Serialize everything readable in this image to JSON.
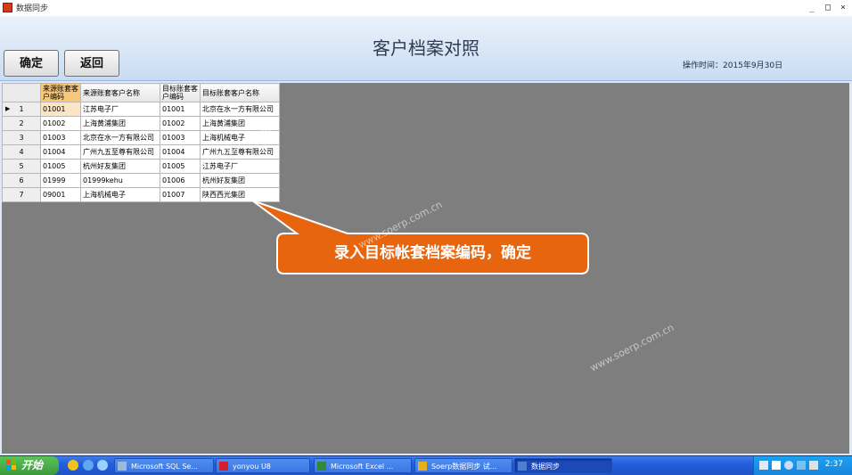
{
  "window": {
    "title": "数据同步",
    "minimize_glyph": "_",
    "maximize_glyph": "□",
    "close_glyph": "×"
  },
  "header": {
    "heading": "客户档案对照",
    "op_time": "操作时间：2015年9月30日"
  },
  "toolbar": {
    "confirm_label": "确定",
    "back_label": "返回"
  },
  "grid": {
    "columns": [
      "来源账套客户编码",
      "来源账套客户名称",
      "目标账套客户编码",
      "目标账套客户名称"
    ],
    "current_row_marker": "▶",
    "rows": [
      {
        "num": "1",
        "src_code": "01001",
        "src_name": "江苏电子厂",
        "tgt_code": "01001",
        "tgt_name": "北京在水一方有限公司"
      },
      {
        "num": "2",
        "src_code": "01002",
        "src_name": "上海黄浦集团",
        "tgt_code": "01002",
        "tgt_name": "上海黄浦集团"
      },
      {
        "num": "3",
        "src_code": "01003",
        "src_name": "北京在水一方有限公司",
        "tgt_code": "01003",
        "tgt_name": "上海机械电子"
      },
      {
        "num": "4",
        "src_code": "01004",
        "src_name": "广州九五至尊有限公司",
        "tgt_code": "01004",
        "tgt_name": "广州九五至尊有限公司"
      },
      {
        "num": "5",
        "src_code": "01005",
        "src_name": "杭州好友集团",
        "tgt_code": "01005",
        "tgt_name": "江苏电子厂"
      },
      {
        "num": "6",
        "src_code": "01999",
        "src_name": "01999kehu",
        "tgt_code": "01006",
        "tgt_name": "杭州好友集团"
      },
      {
        "num": "7",
        "src_code": "09001",
        "src_name": "上海机械电子",
        "tgt_code": "01007",
        "tgt_name": "陕西西光集团"
      }
    ]
  },
  "callout": {
    "text": "录入目标帐套档案编码，确定",
    "fill": "#e8650f",
    "border": "#ffffff"
  },
  "watermarks": [
    "www.soerp.com.cn",
    "www.soerp.com.cn",
    "www.soerp.com.cn"
  ],
  "taskbar": {
    "start_label": "开始",
    "tasks": [
      {
        "label": "Microsoft SQL Se...",
        "icon": "sql-server-icon"
      },
      {
        "label": "yonyou U8",
        "icon": "u8-icon"
      },
      {
        "label": "Microsoft Excel ...",
        "icon": "excel-icon"
      },
      {
        "label": "Soerp数据同步 试...",
        "icon": "soerp-icon"
      },
      {
        "label": "数据同步",
        "icon": "app-icon"
      }
    ],
    "clock": "2:37"
  }
}
